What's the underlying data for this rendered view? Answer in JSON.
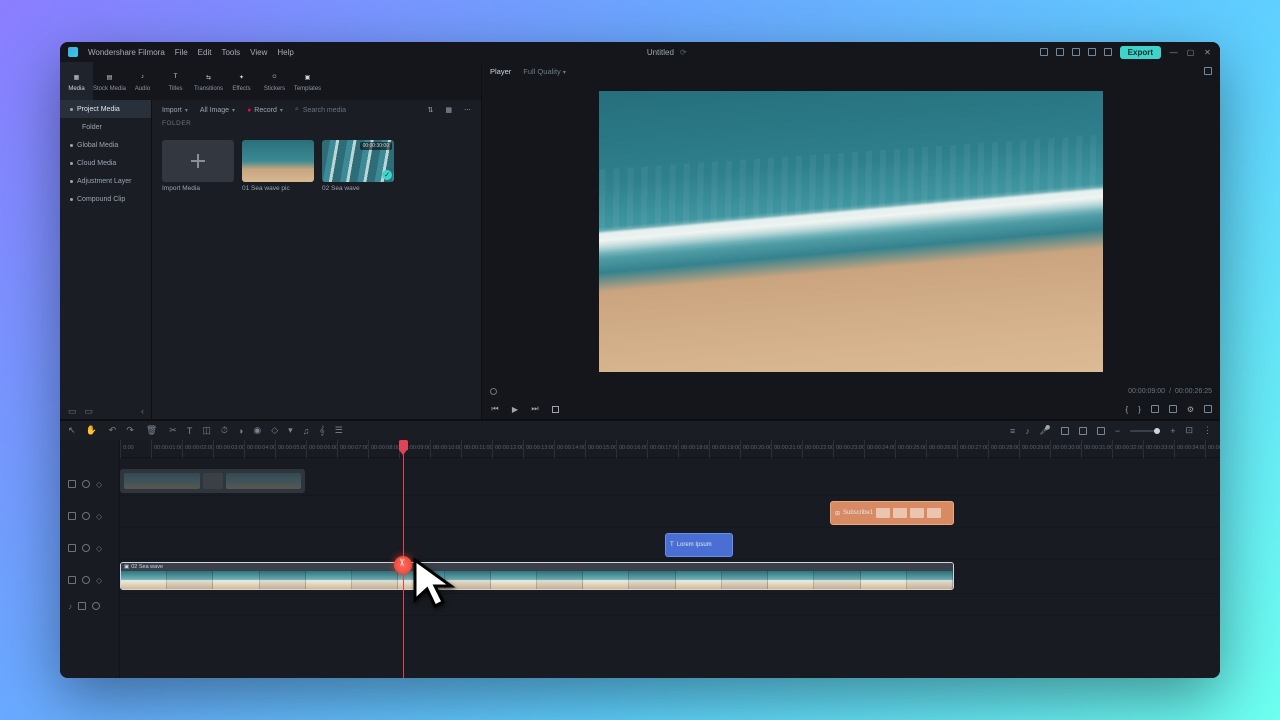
{
  "app": {
    "brand": "Wondershare Filmora",
    "menus": [
      "File",
      "Edit",
      "Tools",
      "View",
      "Help"
    ],
    "project_title": "Untitled",
    "export_label": "Export"
  },
  "tabs": [
    {
      "label": "Media",
      "active": true
    },
    {
      "label": "Stock Media"
    },
    {
      "label": "Audio"
    },
    {
      "label": "Titles"
    },
    {
      "label": "Transitions"
    },
    {
      "label": "Effects"
    },
    {
      "label": "Stickers"
    },
    {
      "label": "Templates"
    }
  ],
  "sidebar": {
    "items": [
      {
        "label": "Project Media",
        "selected": true
      },
      {
        "label": "Folder",
        "child": true
      },
      {
        "label": "Global Media"
      },
      {
        "label": "Cloud Media"
      },
      {
        "label": "Adjustment Layer"
      },
      {
        "label": "Compound Clip"
      }
    ]
  },
  "media_toolbar": {
    "import": "Import",
    "all_image": "All Image",
    "record": "Record",
    "search_placeholder": "Search media",
    "section": "FOLDER"
  },
  "media_cards": [
    {
      "label": "Import Media",
      "type": "import"
    },
    {
      "label": "01 Sea wave pic",
      "type": "sea1"
    },
    {
      "label": "02 Sea wave",
      "type": "sea2",
      "duration": "00:00:30:00",
      "used": true
    }
  ],
  "player": {
    "tab": "Player",
    "quality": "Full Quality",
    "time_current": "00:00:09:00",
    "time_total": "00:00:26:25"
  },
  "timeline": {
    "ruler_step": "00:00:01:00",
    "clips": {
      "ghost_label": "",
      "blue_label": "Lorem Ipsum",
      "orange_label": "Subscribe1",
      "main_label": "02 Sea wave"
    }
  }
}
